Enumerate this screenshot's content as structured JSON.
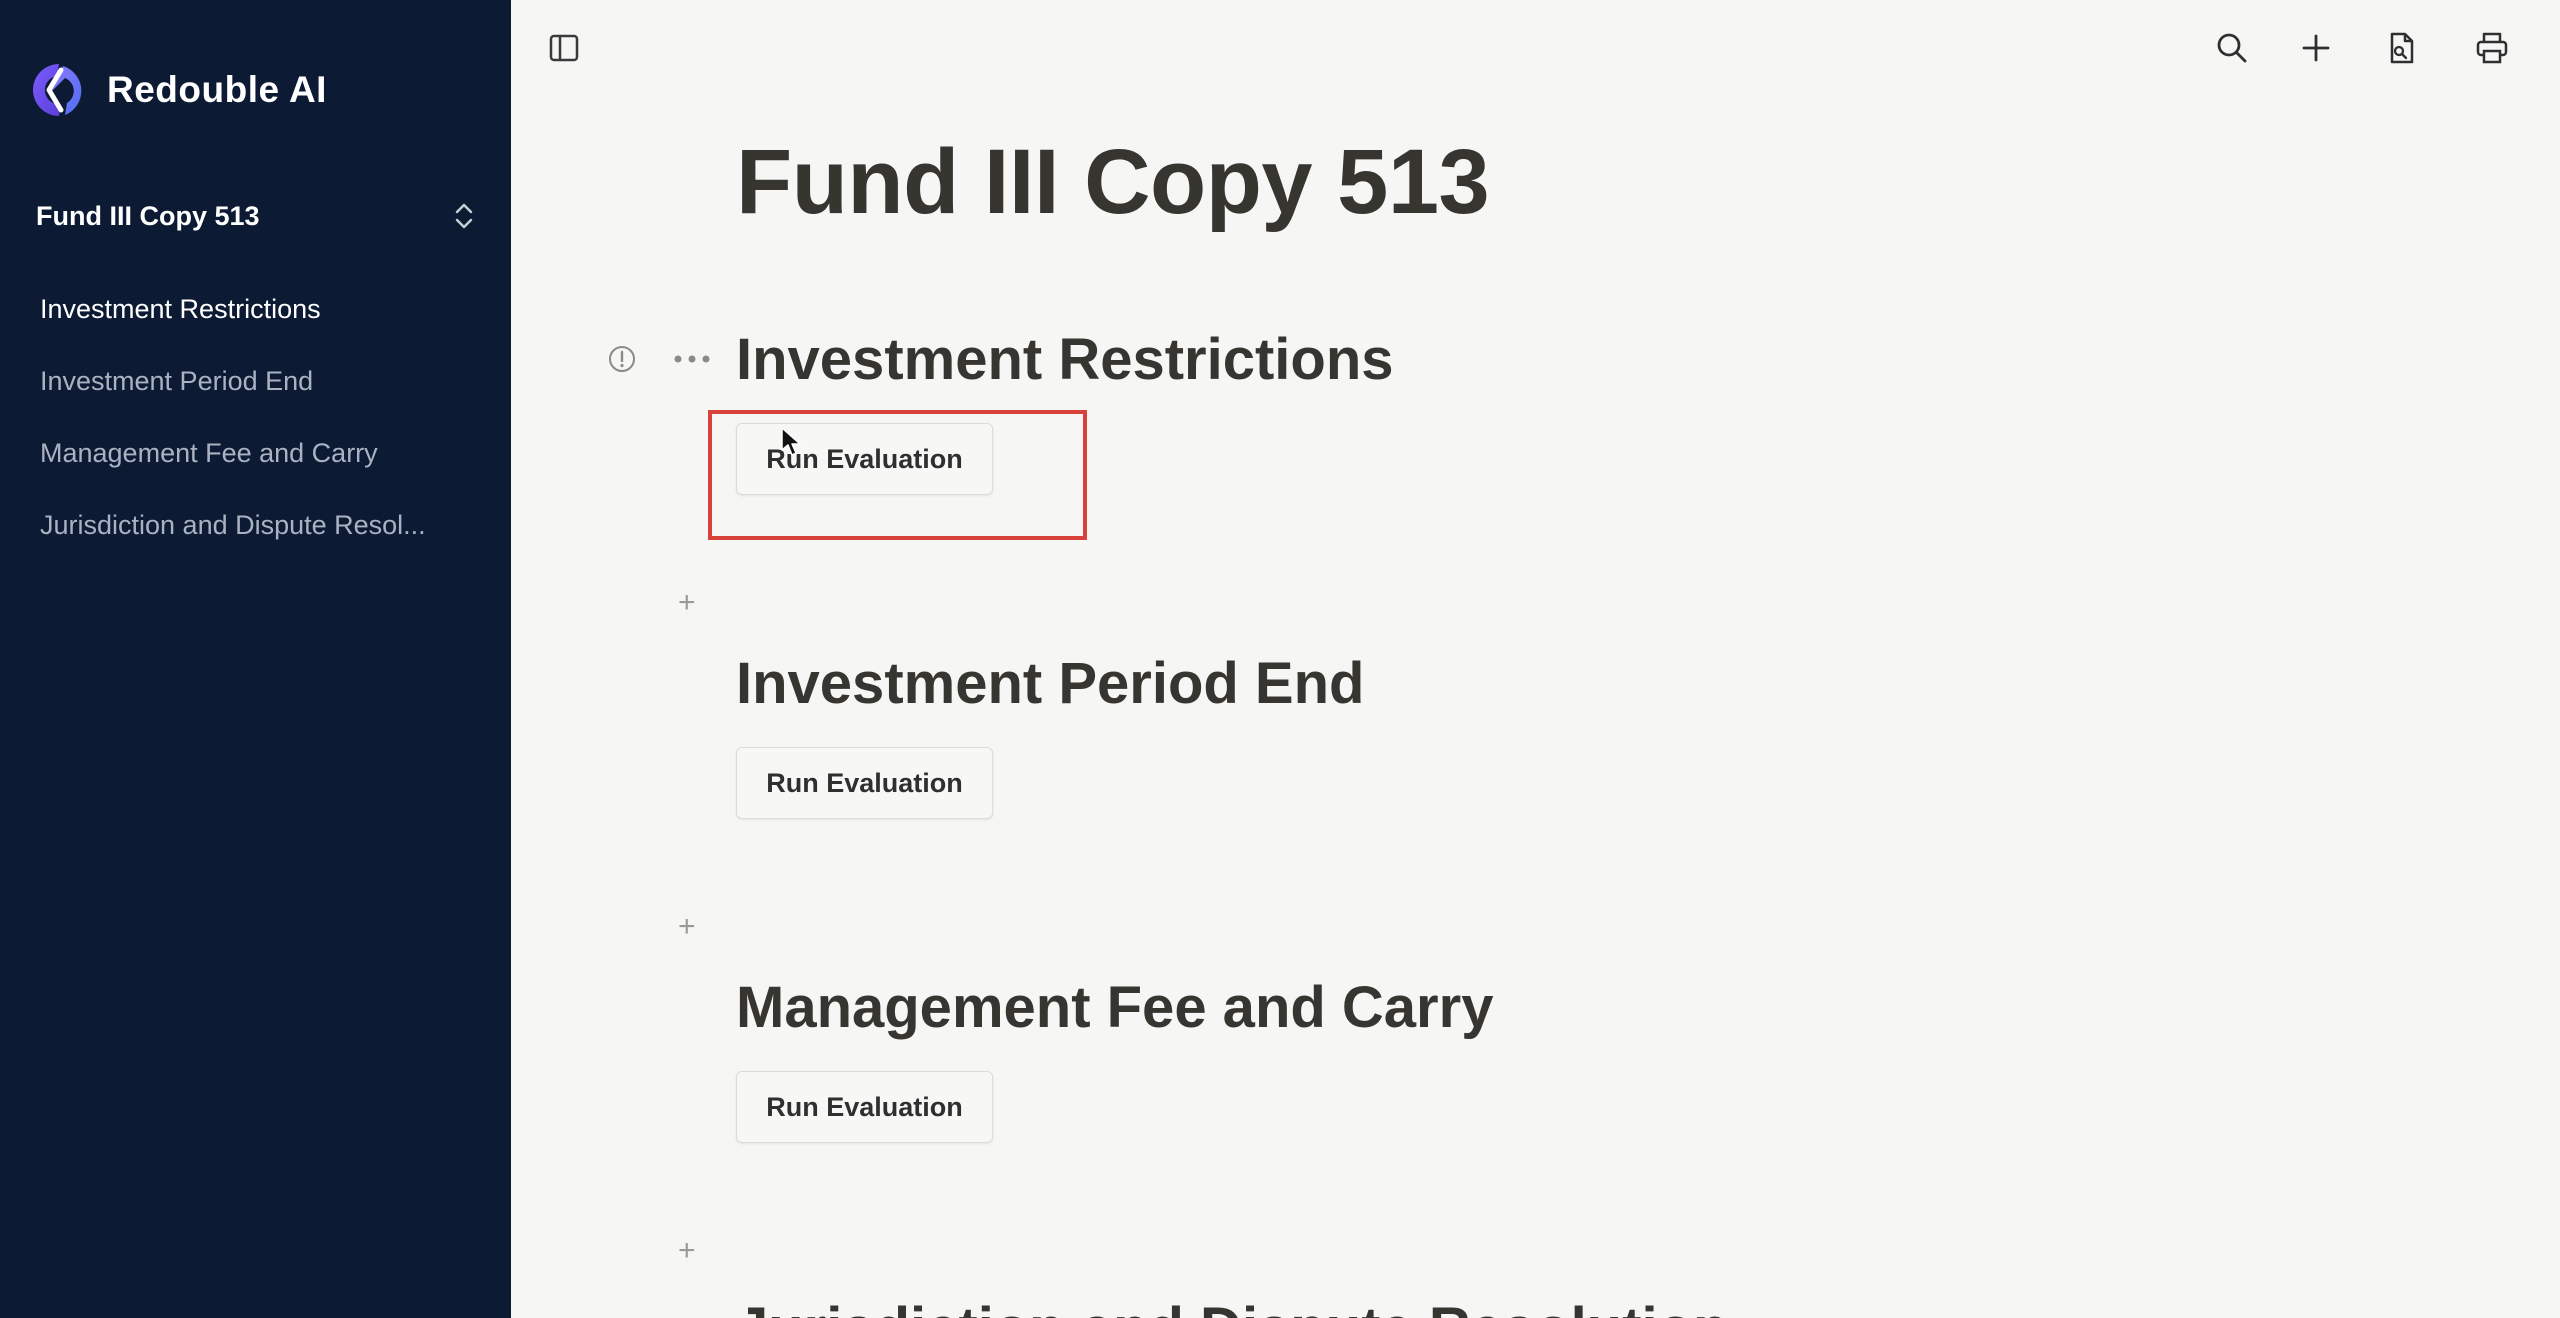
{
  "brand": {
    "name": "Redouble AI",
    "logo": "redouble-logo"
  },
  "workspace": {
    "name": "Fund III Copy 513",
    "icon": "chevron-up-down-icon"
  },
  "nav": {
    "items": [
      {
        "label": "Investment Restrictions",
        "active": true
      },
      {
        "label": "Investment Period End",
        "active": false
      },
      {
        "label": "Management Fee and Carry",
        "active": false
      },
      {
        "label": "Jurisdiction and Dispute Resol...",
        "active": false
      }
    ]
  },
  "toolbar": {
    "icons": [
      "sidebar-toggle-icon",
      "search-icon",
      "plus-icon",
      "file-export-icon",
      "print-icon"
    ]
  },
  "document": {
    "title": "Fund III Copy 513",
    "sections": [
      {
        "heading": "Investment Restrictions",
        "button": "Run Evaluation"
      },
      {
        "heading": "Investment Period End",
        "button": "Run Evaluation"
      },
      {
        "heading": "Management Fee and Carry",
        "button": "Run Evaluation"
      },
      {
        "heading": "Jurisdiction and Dispute Resolution"
      }
    ]
  },
  "colors": {
    "sidebar_bg": "#0c1b33",
    "content_bg": "#f6f6f5",
    "highlight": "#d9413b",
    "heading_text": "#37352f"
  }
}
